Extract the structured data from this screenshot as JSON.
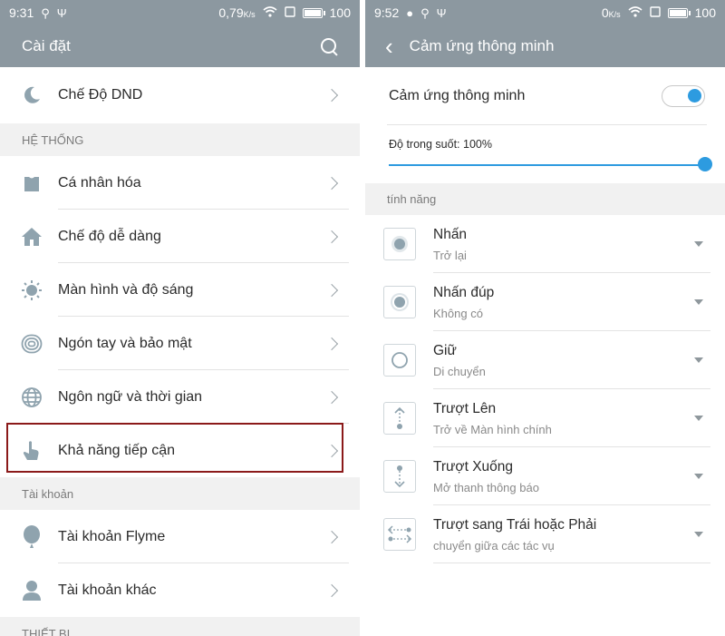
{
  "left": {
    "status": {
      "time": "9:31",
      "data_rate": "0,79",
      "data_unit": "K/s",
      "battery": "100",
      "battery_level": 1.0
    },
    "title": "Cài đặt",
    "items_top": [
      {
        "label": "Chế Độ DND",
        "icon": "moon-icon"
      }
    ],
    "section_system": "HỆ THỐNG",
    "items_system": [
      {
        "label": "Cá nhân hóa",
        "icon": "personalize-icon"
      },
      {
        "label": "Chế độ dễ dàng",
        "icon": "home-icon"
      },
      {
        "label": "Màn hình và độ sáng",
        "icon": "brightness-icon"
      },
      {
        "label": "Ngón tay và bảo mật",
        "icon": "fingerprint-icon"
      },
      {
        "label": "Ngôn ngữ và thời gian",
        "icon": "globe-icon"
      },
      {
        "label": "Khả năng tiếp cận",
        "icon": "hand-pointer-icon"
      }
    ],
    "section_account": "Tài khoản",
    "items_account": [
      {
        "label": "Tài khoản Flyme",
        "icon": "flyme-balloon-icon"
      },
      {
        "label": "Tài khoản khác",
        "icon": "person-icon"
      }
    ],
    "section_device": "THIẾT BỊ"
  },
  "right": {
    "status": {
      "time": "9:52",
      "data_rate": "0",
      "data_unit": "K/s",
      "battery": "100",
      "battery_level": 1.0
    },
    "title": "Cảm ứng thông minh",
    "toggle_label": "Cảm ứng thông minh",
    "toggle_on": true,
    "opacity_label": "Độ trong suốt: 100%",
    "opacity_value": 1.0,
    "section_features": "tính năng",
    "features": [
      {
        "title": "Nhấn",
        "subtitle": "Trở lại",
        "icon": "tap-icon"
      },
      {
        "title": "Nhấn đúp",
        "subtitle": "Không có",
        "icon": "double-tap-icon"
      },
      {
        "title": "Giữ",
        "subtitle": "Di chuyển",
        "icon": "hold-icon"
      },
      {
        "title": "Trượt Lên",
        "subtitle": "Trở về Màn hình chính",
        "icon": "swipe-up-icon"
      },
      {
        "title": "Trượt Xuống",
        "subtitle": "Mở thanh thông báo",
        "icon": "swipe-down-icon"
      },
      {
        "title": "Trượt sang Trái hoặc Phải",
        "subtitle": "chuyển giữa các tác vụ",
        "icon": "swipe-horizontal-icon"
      }
    ]
  },
  "colors": {
    "bar": "#8c98a0",
    "accent": "#2d9be0",
    "icon": "#8fa3ae",
    "highlight": "#8b1a1a"
  }
}
